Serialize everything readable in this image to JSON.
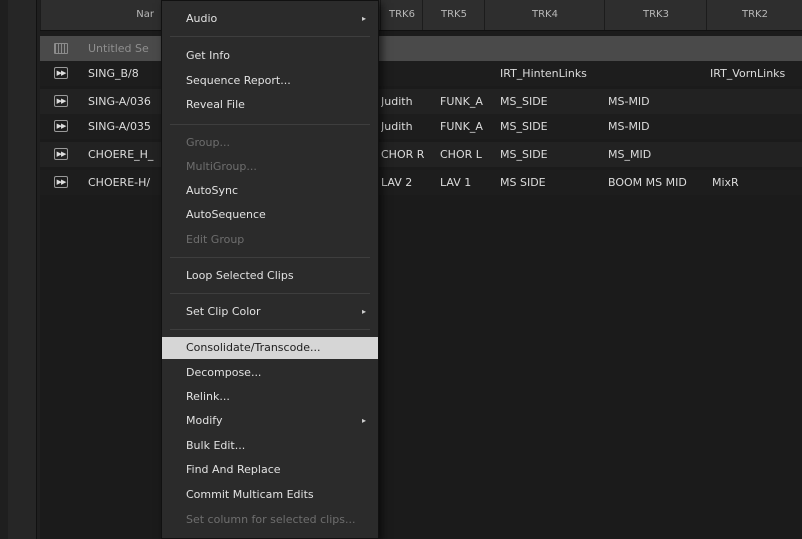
{
  "columns": {
    "name": "Nar",
    "trk6": "TRK6",
    "trk5": "TRK5",
    "trk4": "TRK4",
    "trk3": "TRK3",
    "trk2": "TRK2"
  },
  "rows": [
    {
      "name": "Untitled Se",
      "trk6": "",
      "trk5": "",
      "trk4": "",
      "trk3": "",
      "trk2": "",
      "icon": "sequence-icon",
      "selected": true
    },
    {
      "name": "SING_B/8",
      "trk6": "",
      "trk5": "",
      "trk4": "IRT_HintenLinks",
      "trk3": "",
      "trk2": "IRT_VornLinks",
      "icon": "clip-icon"
    },
    {
      "name": "SING-A/036",
      "trk6": "Judith",
      "trk5": "FUNK_A",
      "trk4": "MS_SIDE",
      "trk3": "MS-MID",
      "trk2": "",
      "icon": "clip-icon"
    },
    {
      "name": "SING-A/035",
      "trk6": "Judith",
      "trk5": "FUNK_A",
      "trk4": "MS_SIDE",
      "trk3": "MS-MID",
      "trk2": "",
      "icon": "clip-icon"
    },
    {
      "name": "CHOERE_H_",
      "trk6": "CHOR R",
      "trk5": "CHOR L",
      "trk4": "MS_SIDE",
      "trk3": "MS_MID",
      "trk2": "",
      "icon": "clip-icon"
    },
    {
      "name": "CHOERE-H/",
      "trk6": "LAV 2",
      "trk5": "LAV 1",
      "trk4": "MS SIDE",
      "trk3": "BOOM MS MID",
      "trk2": "MixR",
      "icon": "clip-icon"
    }
  ],
  "menu": {
    "audio": "Audio",
    "get_info": "Get Info",
    "sequence_report": "Sequence Report...",
    "reveal_file": "Reveal File",
    "group": "Group...",
    "multigroup": "MultiGroup...",
    "autosync": "AutoSync",
    "autosequence": "AutoSequence",
    "edit_group": "Edit Group",
    "loop_selected_clips": "Loop Selected Clips",
    "set_clip_color": "Set Clip Color",
    "consolidate_transcode": "Consolidate/Transcode...",
    "decompose": "Decompose...",
    "relink": "Relink...",
    "modify": "Modify",
    "bulk_edit": "Bulk Edit...",
    "find_and_replace": "Find And Replace",
    "commit_multicam_edits": "Commit Multicam Edits",
    "set_column_for_selected_clips": "Set column for selected clips...",
    "submenu_arrow": "▸"
  },
  "icons": {
    "sequence": "sequence-icon",
    "clip": "clip-icon",
    "submenu": "chevron-right-icon"
  },
  "colors": {
    "menu_bg": "#2b2b2b",
    "highlight_bg": "#d6d6d6",
    "selected_row": "#4a4a4a",
    "disabled_text": "#6e6e6e"
  }
}
